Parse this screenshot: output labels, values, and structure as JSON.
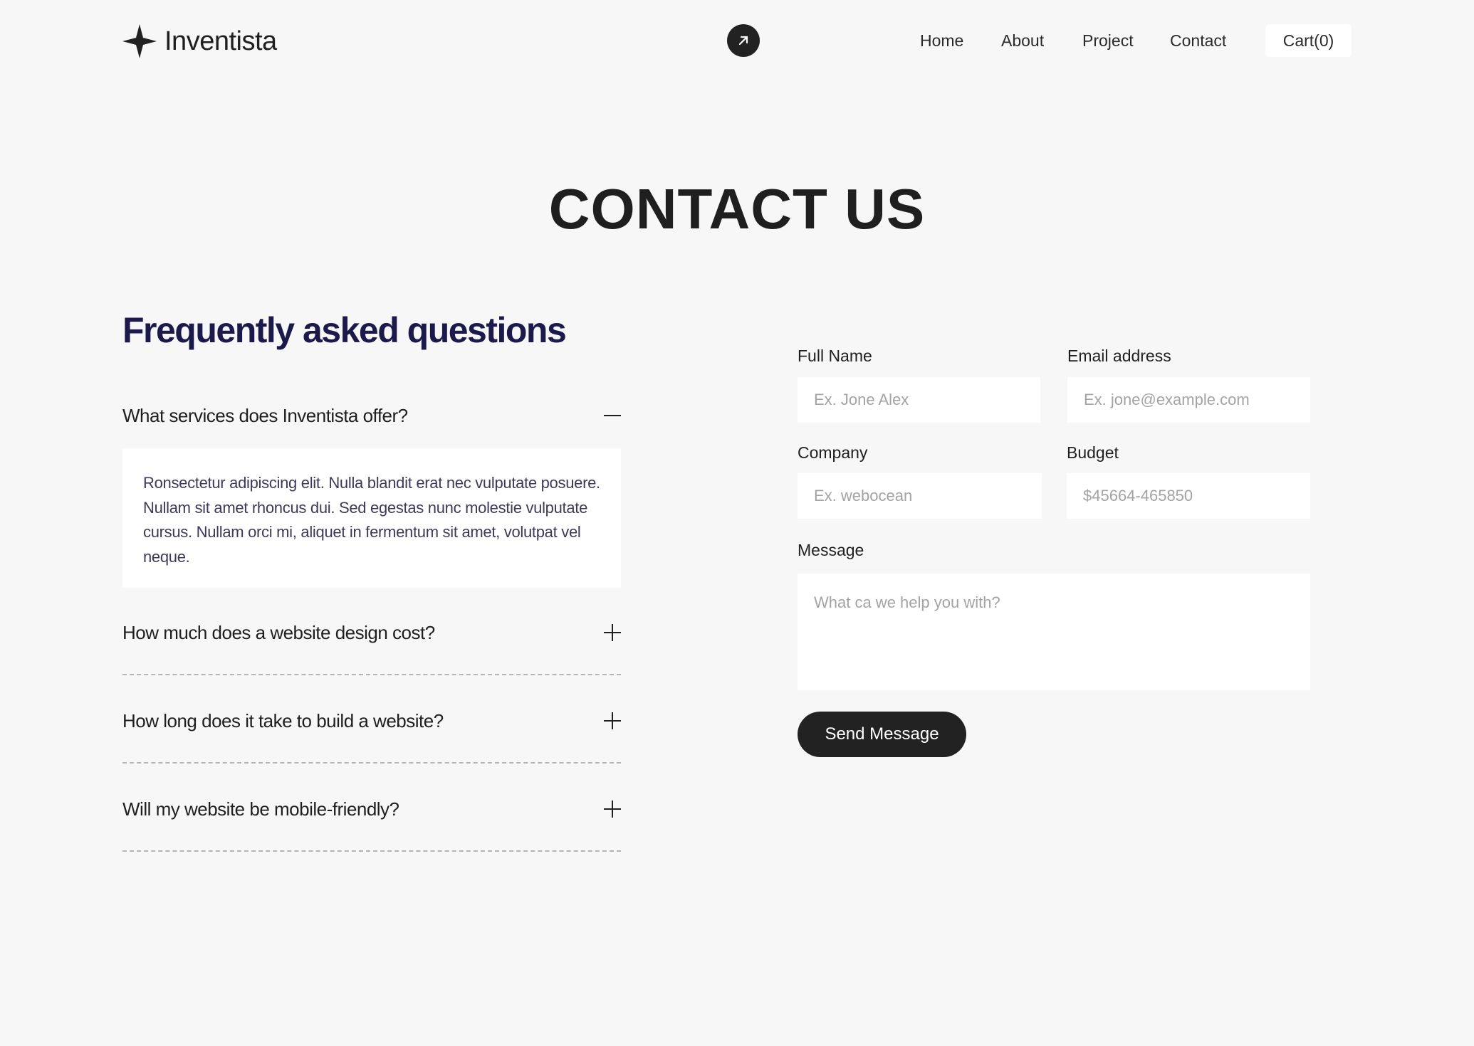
{
  "header": {
    "brand": "Inventista",
    "nav": [
      {
        "label": "Home"
      },
      {
        "label": "About"
      },
      {
        "label": "Project"
      },
      {
        "label": "Contact"
      }
    ],
    "cart_label": "Cart(0)",
    "center_icon": "arrow-up-right-icon"
  },
  "page_title": "CONTACT US",
  "faq": {
    "heading": "Frequently asked questions",
    "items": [
      {
        "question": "What services does Inventista offer?",
        "expanded": true,
        "answer": "Ronsectetur adipiscing elit. Nulla blandit erat nec vulputate posuere. Nullam sit amet rhoncus dui. Sed egestas nunc molestie vulputate cursus. Nullam orci mi, aliquet in fermentum sit amet, volutpat vel neque."
      },
      {
        "question": "How much does a website design cost?",
        "expanded": false
      },
      {
        "question": "How long does it take to build a website?",
        "expanded": false
      },
      {
        "question": "Will my website be mobile-friendly?",
        "expanded": false
      }
    ]
  },
  "form": {
    "full_name": {
      "label": "Full Name",
      "placeholder": "Ex. Jone Alex",
      "value": ""
    },
    "email": {
      "label": "Email address",
      "placeholder": "Ex. jone@example.com",
      "value": ""
    },
    "company": {
      "label": "Company",
      "placeholder": "Ex. webocean",
      "value": ""
    },
    "budget": {
      "label": "Budget",
      "placeholder": "$45664-465850",
      "value": ""
    },
    "message": {
      "label": "Message",
      "placeholder": "What ca we help you with?",
      "value": ""
    },
    "submit_label": "Send Message"
  },
  "colors": {
    "background": "#f7f7f7",
    "dark": "#222222",
    "heading_navy": "#1c1a4a",
    "placeholder": "#a3a3a3"
  }
}
